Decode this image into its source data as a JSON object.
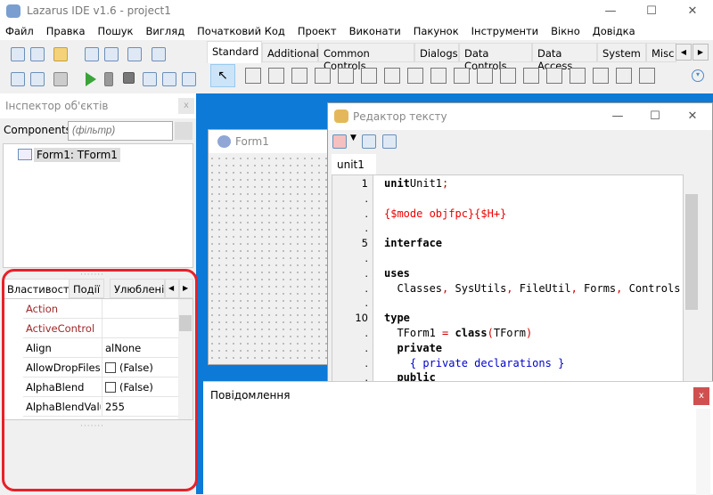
{
  "window": {
    "title": "Lazarus IDE v1.6 - project1",
    "controls": [
      "—",
      "☐",
      "✕"
    ]
  },
  "menu": [
    "Файл",
    "Правка",
    "Пошук",
    "Вигляд",
    "Початковий Код",
    "Проект",
    "Виконати",
    "Пакунок",
    "Інструменти",
    "Вікно",
    "Довідка"
  ],
  "palette": {
    "tabs": [
      "Standard",
      "Additional",
      "Common Controls",
      "Dialogs",
      "Data Controls",
      "Data Access",
      "System",
      "Misc"
    ],
    "active": "Standard"
  },
  "inspector": {
    "title": "Інспектор об'єктів",
    "components_label": "Components",
    "filter_placeholder": "(фільтр)",
    "tree_item": "Form1: TForm1",
    "tabs": [
      "Властивості",
      "Події",
      "Улюблені"
    ],
    "properties": [
      {
        "name": "Action",
        "value": "",
        "highlight": true
      },
      {
        "name": "ActiveControl",
        "value": "",
        "highlight": true
      },
      {
        "name": "Align",
        "value": "alNone"
      },
      {
        "name": "AllowDropFiles",
        "value": "(False)",
        "checkbox": true
      },
      {
        "name": "AlphaBlend",
        "value": "(False)",
        "checkbox": true
      },
      {
        "name": "AlphaBlendValue",
        "value": "255"
      }
    ]
  },
  "form_designer": {
    "title": "Form1"
  },
  "editor": {
    "title": "Редактор тексту",
    "tab": "unit1",
    "gutter": [
      "1",
      ".",
      ".",
      ".",
      "5",
      ".",
      ".",
      ".",
      ".",
      "10",
      ".",
      ".",
      ".",
      "."
    ],
    "lines": [
      [
        [
          "kw",
          "unit"
        ],
        [
          "",
          "Unit1"
        ],
        [
          "sym",
          ";"
        ]
      ],
      [],
      [
        [
          "dir",
          "{$mode objfpc}{$H+}"
        ]
      ],
      [],
      [
        [
          "kw",
          "interface"
        ]
      ],
      [],
      [
        [
          "kw",
          "uses"
        ]
      ],
      [
        [
          "",
          "  Classes"
        ],
        [
          "sym",
          ","
        ],
        [
          "",
          " SysUtils"
        ],
        [
          "sym",
          ","
        ],
        [
          "",
          " FileUtil"
        ],
        [
          "sym",
          ","
        ],
        [
          "",
          " Forms"
        ],
        [
          "sym",
          ","
        ],
        [
          "",
          " Controls"
        ]
      ],
      [],
      [
        [
          "kw",
          "type"
        ]
      ],
      [
        [
          "",
          "  TForm1 "
        ],
        [
          "sym",
          "="
        ],
        [
          "kw",
          " class"
        ],
        [
          "sym",
          "("
        ],
        [
          "",
          "TForm"
        ],
        [
          "sym",
          ")"
        ]
      ],
      [
        [
          "kw",
          "  private"
        ]
      ],
      [
        [
          "cm",
          "    { private declarations }"
        ]
      ],
      [
        [
          "kw",
          "  public"
        ]
      ]
    ]
  },
  "messages": {
    "title": "Повідомлення",
    "close": "x"
  },
  "colors": {
    "desktop": "#0c7ad6",
    "highlight_outline": "#e8202a",
    "directive": "#ee0000",
    "comment": "#0000cc"
  }
}
